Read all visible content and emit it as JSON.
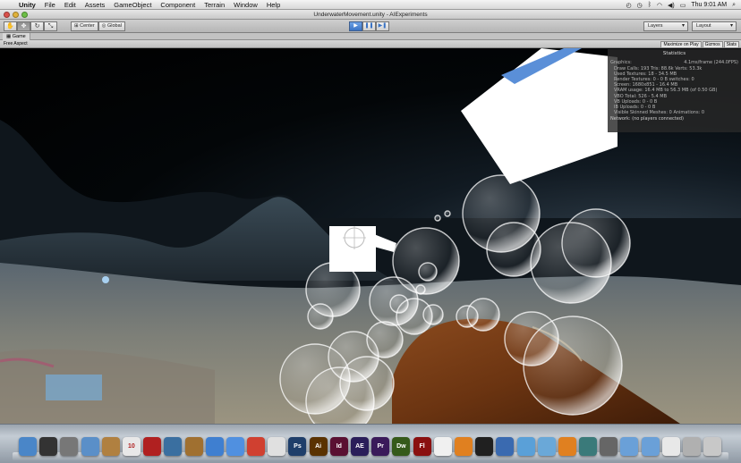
{
  "menubar": {
    "app_name": "Unity",
    "items": [
      "File",
      "Edit",
      "Assets",
      "GameObject",
      "Component",
      "Terrain",
      "Window",
      "Help"
    ],
    "clock": "Thu 9:01 AM"
  },
  "window": {
    "title": "UnderwaterMovement.unity - AIExperiments"
  },
  "toolbar": {
    "pivot_label": "Center",
    "space_label": "Global",
    "layers_label": "Layers",
    "layout_label": "Layout"
  },
  "game_tab": {
    "tab_label": "Game",
    "aspect_label": "Free Aspect",
    "maximize_label": "Maximize on Play",
    "gizmos_label": "Gizmos",
    "stats_label": "Stats"
  },
  "stats": {
    "title": "Statistics",
    "graphics_label": "Graphics:",
    "fps": "4.1ms/frame (244.0FPS)",
    "lines": [
      "Draw Calls: 193   Tris: 88.6k   Verts: 53.3k",
      "Used Textures: 18 - 34.5 MB",
      "Render Textures: 0 - 0 B   switches: 0",
      "Screen: 1680x851 - 16.4 MB",
      "VRAM usage: 16.4 MB to 56.3 MB (of 0.50 GB)",
      "VBO Total: 526 - 5.4 MB",
      "VB Uploads: 0 - 0 B",
      "IB Uploads: 0 - 0 B",
      "Visible Skinned Meshes: 0      Animations: 0"
    ],
    "network": "Network: (no players connected)"
  },
  "colors": {
    "play_active": "#3a73c4",
    "stats_bg": "#282828",
    "cube": "#ffffff",
    "log": "#6b3411",
    "water_top": "#000000"
  },
  "dock": {
    "icons": [
      {
        "name": "finder-icon",
        "label": "",
        "color": "#4a86c8"
      },
      {
        "name": "activity-monitor-icon",
        "label": "",
        "color": "#333333"
      },
      {
        "name": "system-preferences-icon",
        "label": "",
        "color": "#777777"
      },
      {
        "name": "preview-icon",
        "label": "",
        "color": "#5a8fc8"
      },
      {
        "name": "book-icon",
        "label": "",
        "color": "#b08040"
      },
      {
        "name": "calendar-icon",
        "label": "10",
        "color": "#e8e8e8"
      },
      {
        "name": "photobooth-icon",
        "label": "",
        "color": "#b02020"
      },
      {
        "name": "iphoto-icon",
        "label": "",
        "color": "#3a6fa0"
      },
      {
        "name": "garageband-icon",
        "label": "",
        "color": "#a07030"
      },
      {
        "name": "itunes-icon",
        "label": "",
        "color": "#3f7fd0"
      },
      {
        "name": "ichat-icon",
        "label": "",
        "color": "#5090e0"
      },
      {
        "name": "chrome-icon",
        "label": "",
        "color": "#d04030"
      },
      {
        "name": "textedit-icon",
        "label": "",
        "color": "#e0e0e0"
      },
      {
        "name": "photoshop-icon",
        "label": "Ps",
        "color": "#1e3e6a"
      },
      {
        "name": "illustrator-icon",
        "label": "Ai",
        "color": "#5a3200"
      },
      {
        "name": "indesign-icon",
        "label": "Id",
        "color": "#5a1032"
      },
      {
        "name": "aftereffects-icon",
        "label": "AE",
        "color": "#2a1e5a"
      },
      {
        "name": "premiere-icon",
        "label": "Pr",
        "color": "#3a1a5a"
      },
      {
        "name": "dreamweaver-icon",
        "label": "Dw",
        "color": "#355a1a"
      },
      {
        "name": "flash-icon",
        "label": "Fl",
        "color": "#8a1010"
      },
      {
        "name": "unity-icon",
        "label": "",
        "color": "#f0f0f0"
      },
      {
        "name": "blender-icon",
        "label": "",
        "color": "#e08020"
      },
      {
        "name": "terminal-icon",
        "label": "",
        "color": "#202020"
      },
      {
        "name": "xcode-icon",
        "label": "",
        "color": "#3a6ab0"
      },
      {
        "name": "network-icon",
        "label": "",
        "color": "#5aa0d8"
      },
      {
        "name": "utility-icon",
        "label": "",
        "color": "#6aa8d8"
      },
      {
        "name": "vlc-icon",
        "label": "",
        "color": "#e08020"
      },
      {
        "name": "time-machine-icon",
        "label": "",
        "color": "#3a7a7a"
      },
      {
        "name": "camera-icon",
        "label": "",
        "color": "#666666"
      },
      {
        "name": "applications-folder-icon",
        "label": "",
        "color": "#6aa0d8"
      },
      {
        "name": "documents-folder-icon",
        "label": "",
        "color": "#6aa0d8"
      },
      {
        "name": "pdf-icon",
        "label": "",
        "color": "#e8e8e8"
      },
      {
        "name": "downloads-icon",
        "label": "",
        "color": "#b0b0b0"
      },
      {
        "name": "trash-icon",
        "label": "",
        "color": "#c8c8c8"
      }
    ]
  }
}
